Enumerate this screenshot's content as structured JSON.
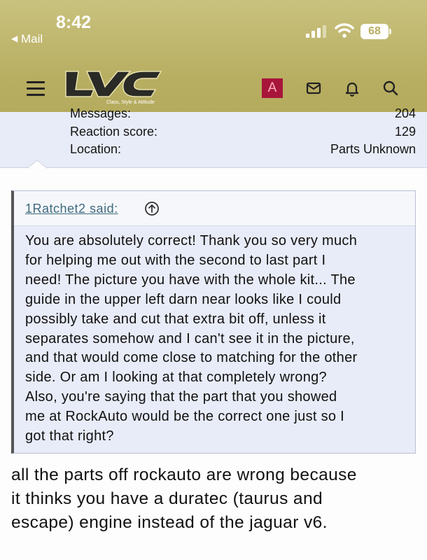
{
  "status_bar": {
    "time": "8:42",
    "back_label": "Mail",
    "battery": "68"
  },
  "header": {
    "logo_text": "LVC",
    "logo_tagline": "Class, Style & Attitude",
    "avatar_letter": "A",
    "icons": [
      "menu-icon",
      "mail-icon",
      "bell-icon",
      "search-icon"
    ],
    "colors": {
      "header_bg": "#b8ae62",
      "avatar_bg": "#a8153a"
    }
  },
  "profile_info": {
    "rows": [
      {
        "label": "Messages:",
        "value": "204"
      },
      {
        "label": "Reaction score:",
        "value": "129"
      },
      {
        "label": "Location:",
        "value": "Parts Unknown"
      }
    ]
  },
  "quote": {
    "author": "1Ratchet2 said:",
    "lines": [
      "You are absolutely correct! Thank you so very much",
      "for helping me out with the second to last part I",
      "need! The picture you have with the whole kit... The",
      "guide in the upper left darn near looks like I could",
      "possibly take and cut that extra bit off, unless it",
      "separates somehow and I can't see it in the picture,",
      "and that would come close to matching for the other",
      "side. Or am I looking at that completely wrong?",
      "Also, you're saying that the part that you showed",
      "me at RockAuto would be the correct one just so I",
      "got that right?"
    ]
  },
  "reply": {
    "lines": [
      "all the parts off rockauto are wrong because",
      "it thinks you have a duratec (taurus and",
      "escape) engine instead of the jaguar v6."
    ]
  }
}
